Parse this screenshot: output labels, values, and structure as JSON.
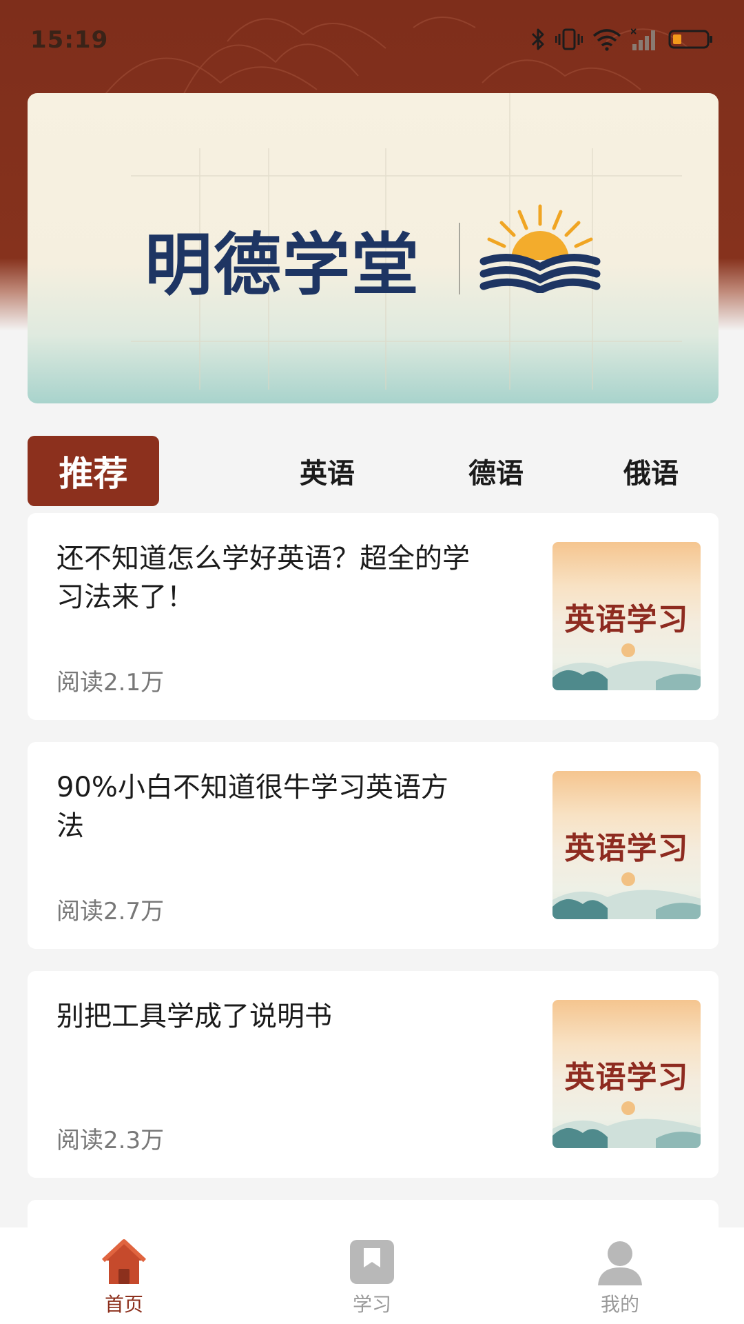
{
  "status_bar": {
    "time": "15:19",
    "icons": [
      "bluetooth-icon",
      "vibrate-icon",
      "wifi-icon",
      "signal-icon",
      "battery-icon"
    ],
    "battery_color": "#f39a1b"
  },
  "banner": {
    "logo_text": "明德学堂"
  },
  "tabs": [
    {
      "label": "推荐",
      "active": true
    },
    {
      "label": "英语",
      "active": false
    },
    {
      "label": "德语",
      "active": false
    },
    {
      "label": "俄语",
      "active": false
    }
  ],
  "articles": [
    {
      "title": "还不知道怎么学好英语？超全的学习法来了！",
      "reads": "阅读2.1万",
      "thumb_text": "英语学习"
    },
    {
      "title": "90%小白不知道很牛学习英语方法",
      "reads": "阅读2.7万",
      "thumb_text": "英语学习"
    },
    {
      "title": "别把工具学成了说明书",
      "reads": "阅读2.3万",
      "thumb_text": "英语学习"
    }
  ],
  "bottom_nav": [
    {
      "label": "首页",
      "icon": "home-icon",
      "active": true
    },
    {
      "label": "学习",
      "icon": "bookmark-book-icon",
      "active": false
    },
    {
      "label": "我的",
      "icon": "user-icon",
      "active": false
    }
  ],
  "colors": {
    "brand": "#8c301d",
    "banner_logo": "#1e3563",
    "thumb_text": "#8e2b20"
  }
}
